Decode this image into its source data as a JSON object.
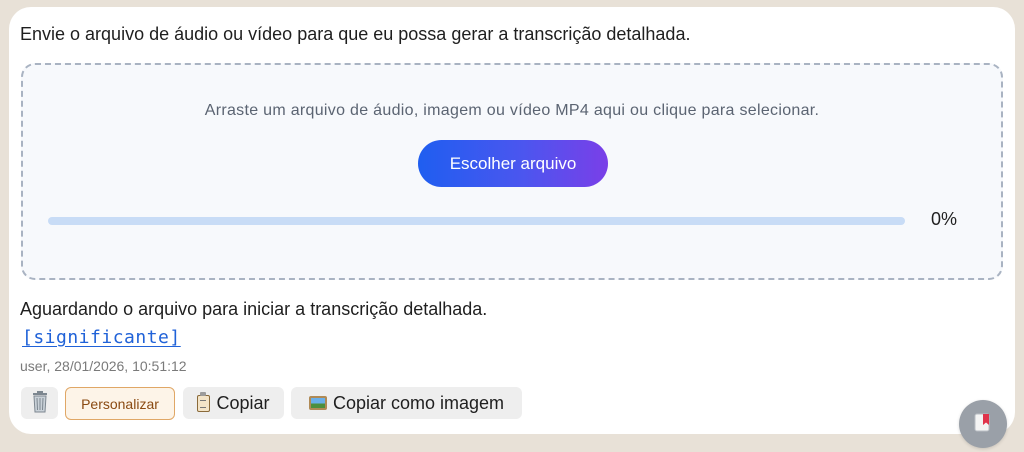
{
  "intro_text": "Envie o arquivo de áudio ou vídeo para que eu possa gerar a transcrição detalhada.",
  "dropzone": {
    "hint": "Arraste um arquivo de áudio, imagem ou vídeo MP4 aqui ou clique para selecionar.",
    "button_label": "Escolher arquivo",
    "progress_percent": 0,
    "progress_label": "0%"
  },
  "status_text": "Aguardando o arquivo para iniciar a transcrição detalhada.",
  "link_text": "[significante]",
  "meta_text": "user, 28/01/2026, 10:51:12",
  "toolbar": {
    "delete_icon": "trash-icon",
    "customize_label": "Personalizar",
    "copy_icon": "clipboard-icon",
    "copy_label": "Copiar",
    "copy_image_icon": "picture-icon",
    "copy_image_label": "Copiar como imagem"
  },
  "fab_icon": "bookmark-icon",
  "colors": {
    "background": "#e8e1d7",
    "card": "#ffffff",
    "accent_start": "#1f5ef0",
    "accent_end": "#7a3fe8",
    "link": "#2062d8",
    "progress_track": "#c8dcf6"
  }
}
